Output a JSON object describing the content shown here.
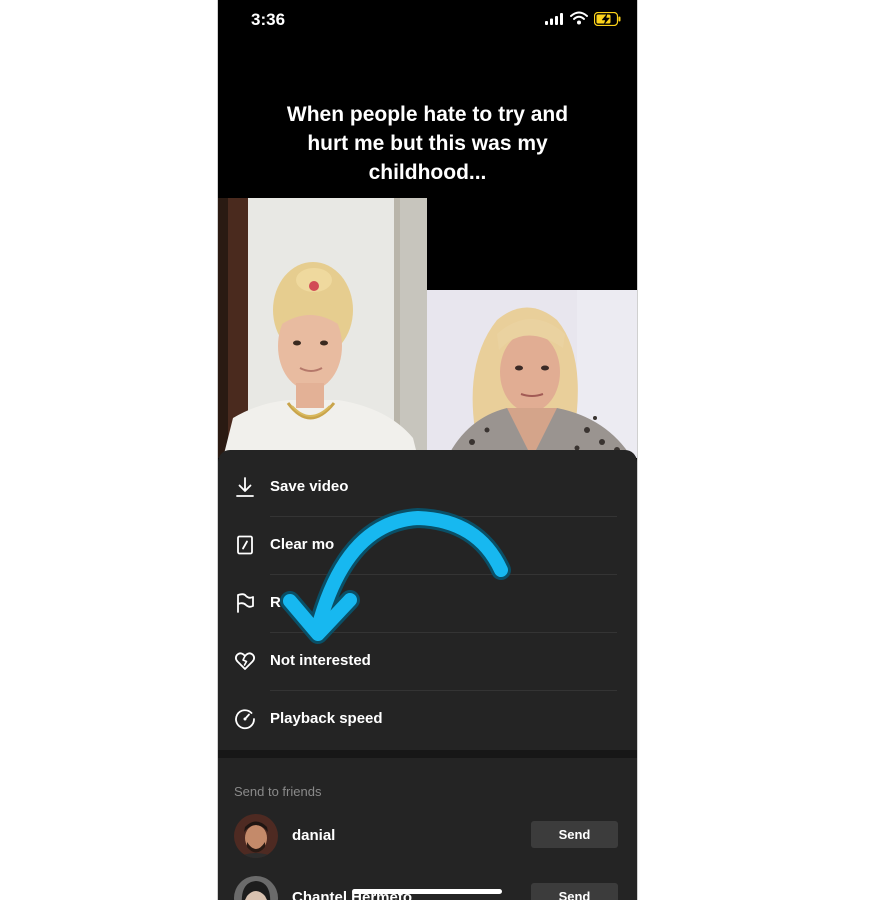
{
  "status_bar": {
    "time": "3:36",
    "icons": [
      "cellular-signal-icon",
      "wifi-icon",
      "battery-charging-icon"
    ]
  },
  "video": {
    "caption_line1": "When people hate to try and",
    "caption_line2": "hurt me but this was my",
    "caption_line3": "childhood..."
  },
  "menu": {
    "items": [
      {
        "label": "Save video",
        "icon": "download-icon"
      },
      {
        "label": "Clear mo",
        "icon": "clear-mode-icon"
      },
      {
        "label": "R",
        "icon": "flag-icon"
      },
      {
        "label": "Not interested",
        "icon": "broken-heart-icon"
      },
      {
        "label": "Playback speed",
        "icon": "speedometer-icon"
      }
    ]
  },
  "friends": {
    "heading": "Send to friends",
    "list": [
      {
        "name": "danial",
        "action": "Send"
      },
      {
        "name": "Chantel Hermeto",
        "action": "Send"
      }
    ]
  },
  "annotation": {
    "color": "#17b8f0",
    "icon": "curved-arrow-icon"
  }
}
